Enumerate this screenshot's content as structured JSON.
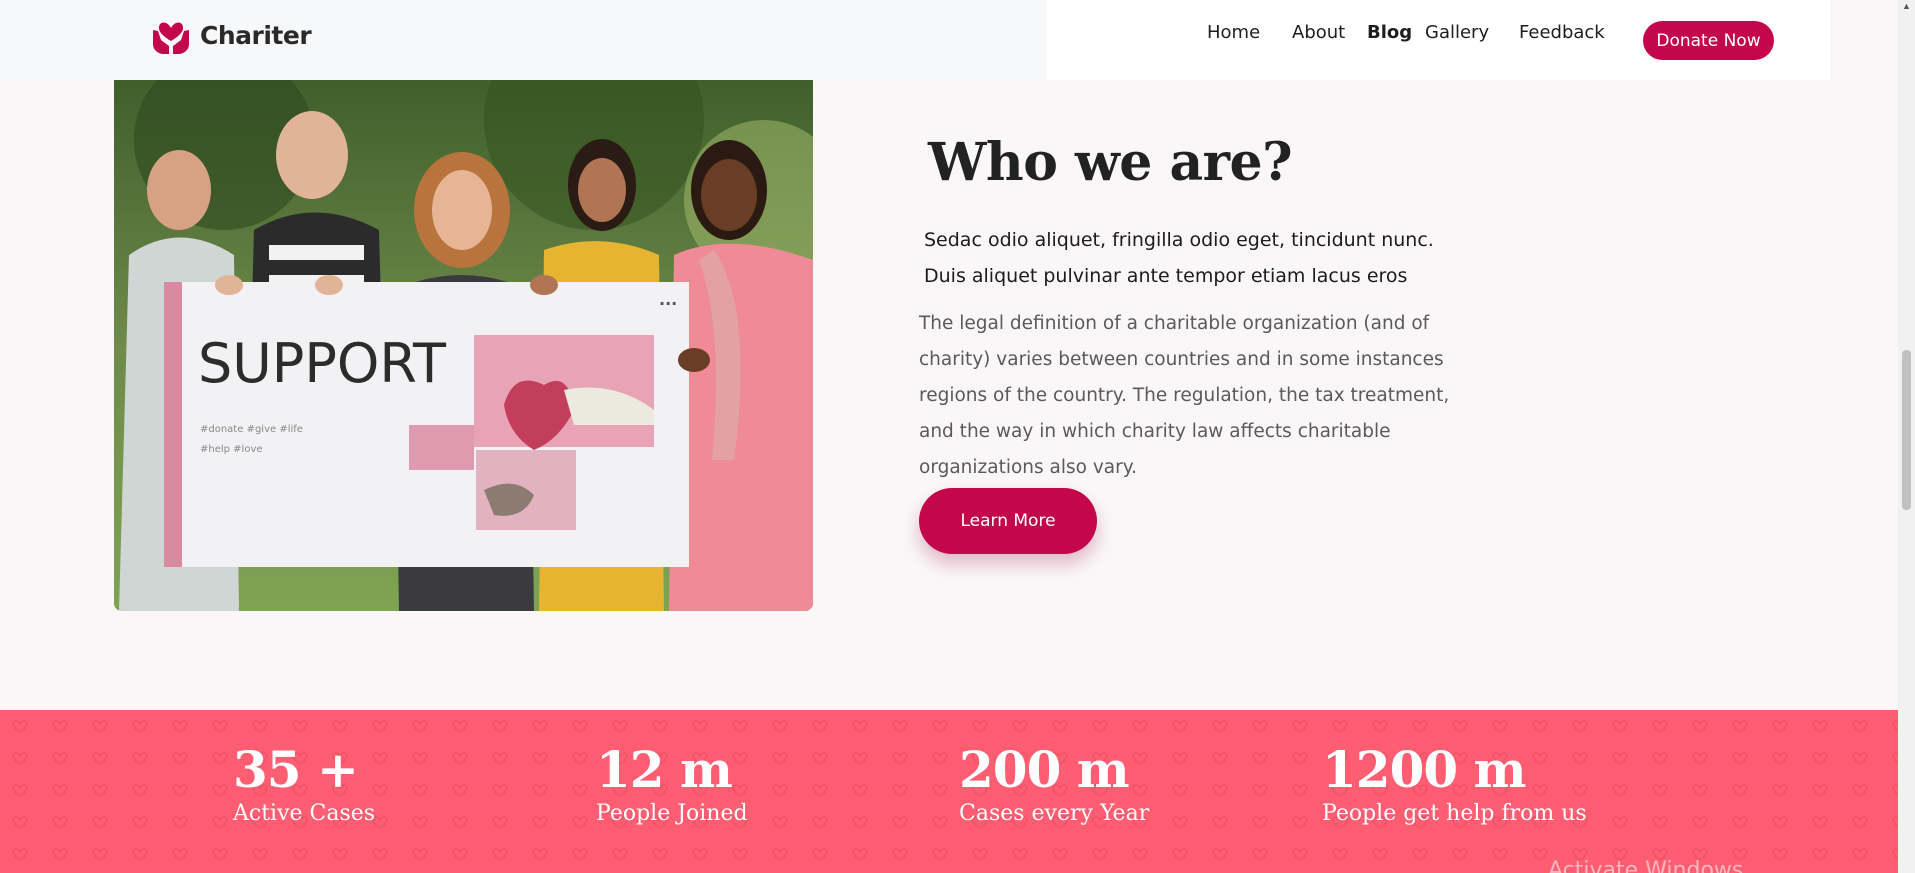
{
  "brand": {
    "name": "Chariter",
    "color": "#c4064c"
  },
  "nav": {
    "items": [
      {
        "label": "Home",
        "active": false
      },
      {
        "label": "About",
        "active": false
      },
      {
        "label": "Blog",
        "active": true
      },
      {
        "label": "Gallery",
        "active": false
      },
      {
        "label": "Feedback",
        "active": false
      }
    ],
    "donate_label": "Donate Now"
  },
  "hero_image": {
    "sign_title": "SUPPORT",
    "sign_tags_line1": "#donate #give #life",
    "sign_tags_line2": "#help #love",
    "sign_menu": "..."
  },
  "about": {
    "title": "Who we are?",
    "lead": "Sedac odio aliquet, fringilla odio eget, tincidunt nunc. Duis aliquet pulvinar ante tempor etiam lacus eros",
    "body": "The legal definition of a charitable organization (and of charity) varies between countries and in some instances regions of the country. The regulation, the tax treatment, and the way in which charity law affects charitable organizations also vary.",
    "cta_label": "Learn More"
  },
  "stats": {
    "background": "#fe5d72",
    "items": [
      {
        "value": "35 +",
        "label": "Active Cases"
      },
      {
        "value": "12 m",
        "label": "People Joined"
      },
      {
        "value": "200 m",
        "label": "Cases every Year"
      },
      {
        "value": "1200 m",
        "label": "People get help from us"
      }
    ]
  },
  "os_watermark": "Activate Windows"
}
